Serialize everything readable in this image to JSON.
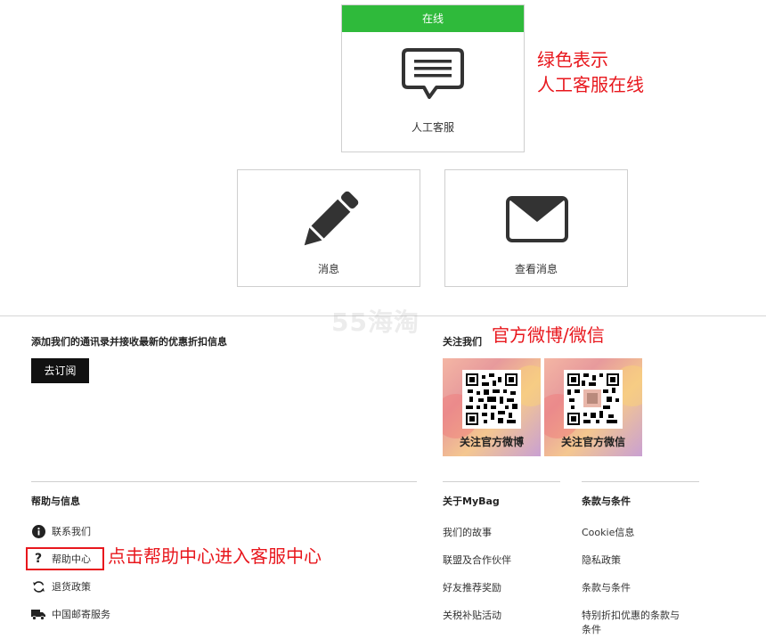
{
  "service": {
    "chat": {
      "status": "在线",
      "label": "人工客服"
    },
    "message": {
      "label": "消息"
    },
    "mail": {
      "label": "查看消息"
    }
  },
  "annotations": {
    "green_line1": "绿色表示",
    "green_line2": "人工客服在线",
    "social": "官方微博/微信",
    "help": "点击帮助中心进入客服中心"
  },
  "watermark": "55海淘",
  "subscribe": {
    "text": "添加我们的通讯录并接收最新的优惠折扣信息",
    "button": "去订阅"
  },
  "follow": {
    "title": "关注我们",
    "weibo_caption": "关注官方微博",
    "wechat_caption": "关注官方微信"
  },
  "help": {
    "title": "帮助与信息",
    "items": [
      {
        "label": "联系我们",
        "icon": "info-icon"
      },
      {
        "label": "帮助中心",
        "icon": "question-icon"
      },
      {
        "label": "退货政策",
        "icon": "refresh-icon"
      },
      {
        "label": "中国邮寄服务",
        "icon": "truck-icon"
      }
    ]
  },
  "about": {
    "title": "关于MyBag",
    "items": [
      "我们的故事",
      "联盟及合作伙伴",
      "好友推荐奖励",
      "关税补贴活动"
    ]
  },
  "terms": {
    "title": "条款与条件",
    "items": [
      "Cookie信息",
      "隐私政策",
      "条款与条件",
      "特别折扣优惠的条款与",
      "条件"
    ]
  },
  "colors": {
    "online_green": "#2fba3b",
    "annotation_red": "#e8171d",
    "button_black": "#111111"
  }
}
